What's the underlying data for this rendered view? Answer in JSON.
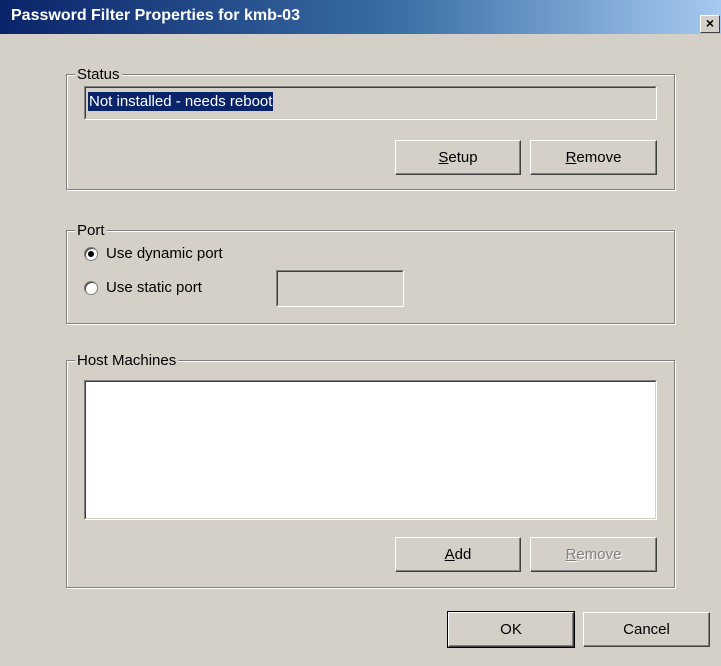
{
  "window": {
    "title": "Password Filter Properties for kmb-03",
    "close_glyph": "×"
  },
  "status": {
    "legend": "Status",
    "value": "Not installed - needs reboot",
    "setup": {
      "accel": "S",
      "rest": "etup"
    },
    "remove": {
      "accel": "R",
      "rest": "emove"
    }
  },
  "port": {
    "legend": "Port",
    "dynamic_label": "Use dynamic port",
    "static_label": "Use static port",
    "selected": "dynamic",
    "static_value": ""
  },
  "hosts": {
    "legend": "Host Machines",
    "items": [],
    "add": {
      "accel": "A",
      "rest": "dd"
    },
    "remove": {
      "accel": "R",
      "rest": "emove"
    }
  },
  "footer": {
    "ok_label": "OK",
    "cancel_label": "Cancel"
  }
}
